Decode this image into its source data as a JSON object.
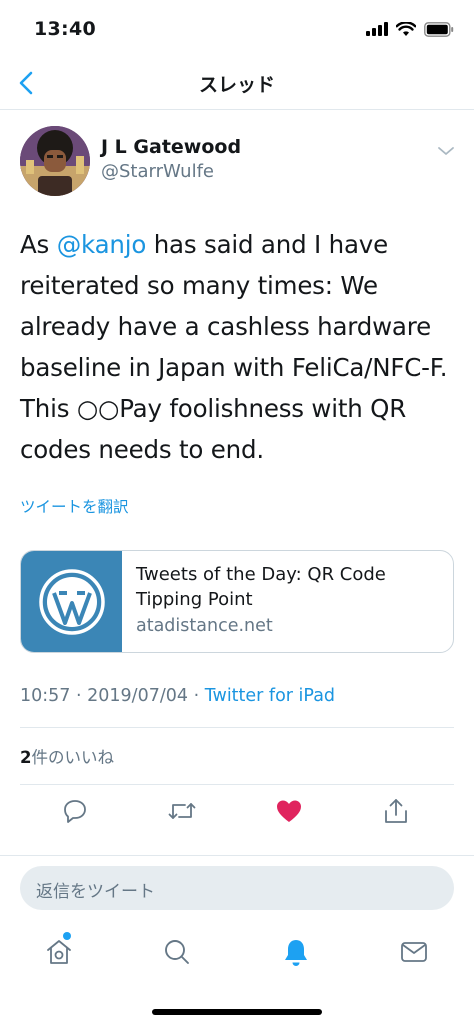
{
  "status_bar": {
    "time": "13:40"
  },
  "nav": {
    "title": "スレッド"
  },
  "tweet": {
    "author_name": "J L Gatewood",
    "author_handle": "@StarrWulfe",
    "text_before": "As ",
    "mention": "@kanjo",
    "text_after": " has said and I have reiterated so many times: We already have a cashless hardware baseline in Japan with FeliCa/NFC-F. This ○○Pay foolishness with QR codes needs to end.",
    "translate_label": "ツイートを翻訳"
  },
  "link_card": {
    "title": "Tweets of the Day: QR Code Tipping Point",
    "domain": "atadistance.net",
    "thumb_icon": "wordpress-logo",
    "thumb_color": "#3b86b6"
  },
  "meta": {
    "time": "10:57",
    "date": "2019/07/04",
    "source": "Twitter for iPad",
    "separator": " · "
  },
  "likes": {
    "count": "2",
    "label": "件のいいね"
  },
  "actions": {
    "reply_icon": "comment-icon",
    "retweet_icon": "retweet-icon",
    "like_icon": "heart-icon",
    "like_color": "#e0245e",
    "share_icon": "share-icon"
  },
  "composer": {
    "placeholder": "返信をツイート"
  },
  "tab_bar": {
    "items": [
      "home-icon",
      "search-icon",
      "notifications-icon",
      "messages-icon"
    ],
    "accent": "#1da1f2"
  }
}
